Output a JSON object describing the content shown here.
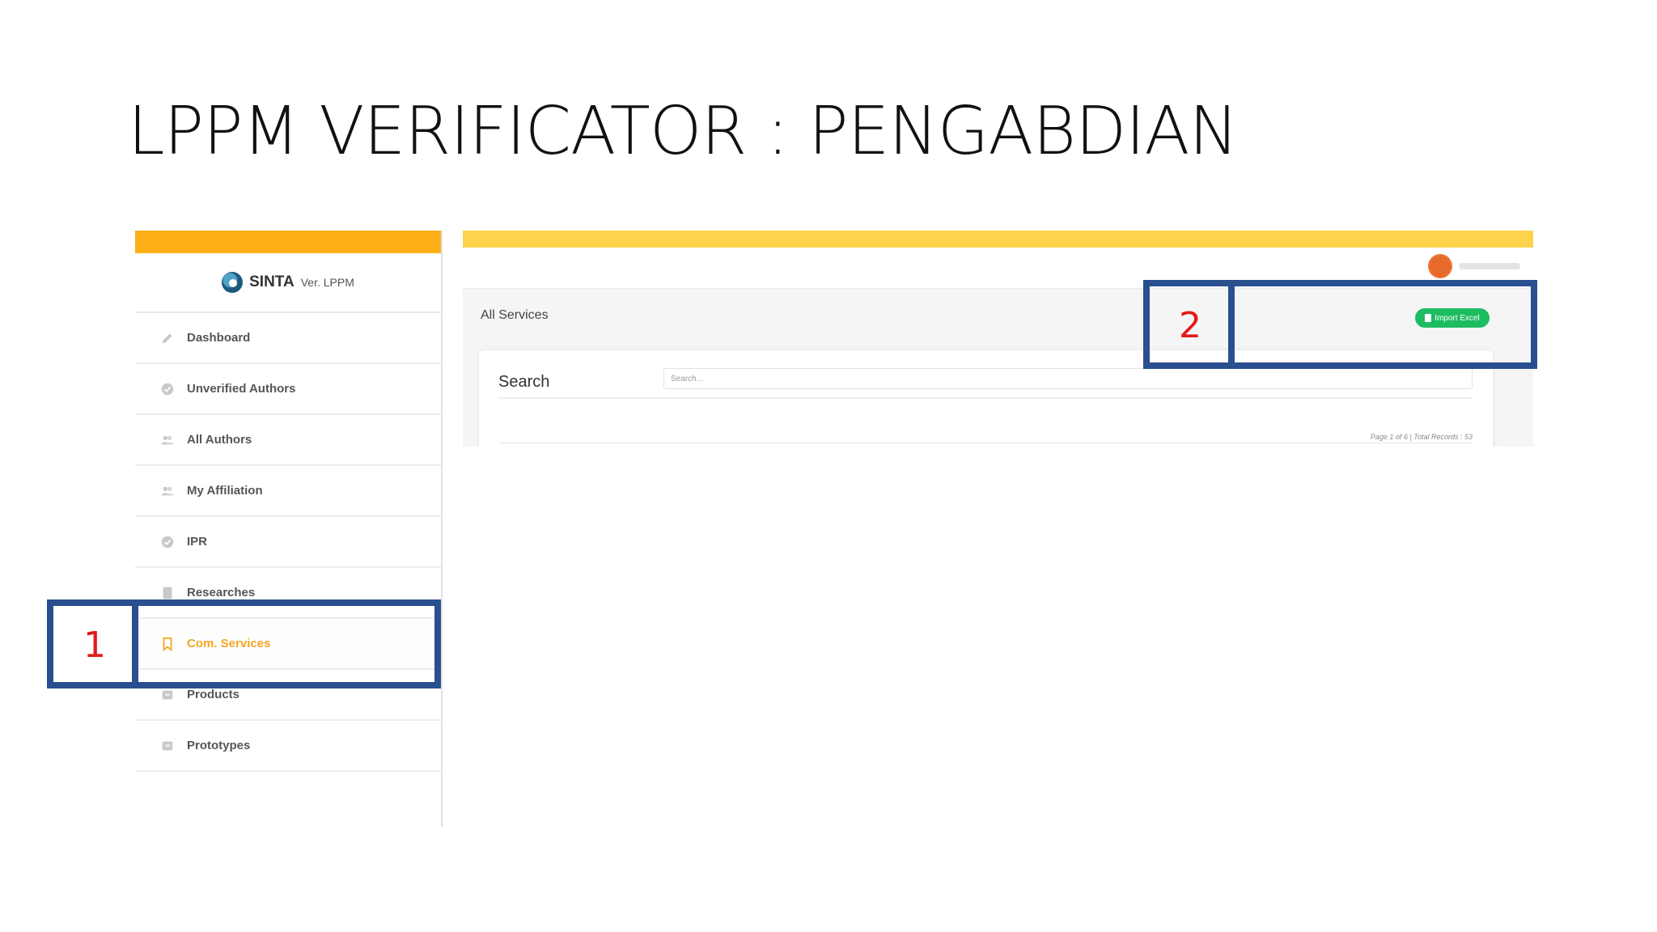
{
  "slide": {
    "title": "LPPM VERIFICATOR : PENGABDIAN"
  },
  "sidebar": {
    "logo": {
      "brand": "SINTA",
      "version": "Ver. LPPM"
    },
    "items": [
      {
        "label": "Dashboard",
        "icon": "pencil-icon"
      },
      {
        "label": "Unverified Authors",
        "icon": "badge-check-icon"
      },
      {
        "label": "All Authors",
        "icon": "users-icon"
      },
      {
        "label": "My Affiliation",
        "icon": "users-icon"
      },
      {
        "label": "IPR",
        "icon": "badge-check-icon"
      },
      {
        "label": "Researches",
        "icon": "book-icon"
      },
      {
        "label": "Com. Services",
        "icon": "bookmark-icon",
        "active": true
      },
      {
        "label": "Products",
        "icon": "box-icon"
      },
      {
        "label": "Prototypes",
        "icon": "box-icon"
      }
    ]
  },
  "main": {
    "page_label": "All Services",
    "import_button": "Import Excel",
    "search": {
      "label": "Search",
      "placeholder": "Search..."
    },
    "pager": "Page 1 of 6 | Total Records : 53"
  },
  "callouts": [
    {
      "number": "1"
    },
    {
      "number": "2"
    }
  ],
  "colors": {
    "sidebar_topbar": "#fdaf17",
    "main_topbar": "#fcd34a",
    "active_item": "#f5a623",
    "import_button": "#1ebc61",
    "callout_border": "#2a4f8f",
    "callout_number": "#e21b1b"
  }
}
